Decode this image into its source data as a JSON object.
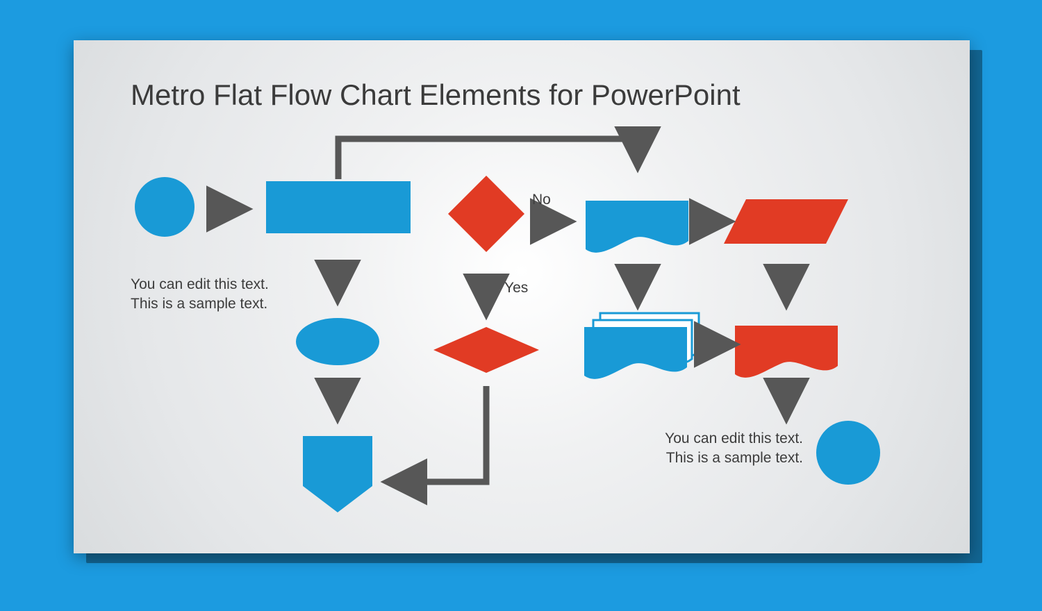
{
  "title": "Metro Flat Flow Chart Elements for PowerPoint",
  "labels": {
    "no": "No",
    "yes": "Yes"
  },
  "captions": {
    "top_left": "You can edit this text. This is a sample text.",
    "bottom_right": "You can edit this text. This is a sample text."
  },
  "colors": {
    "blue": "#199ad6",
    "red": "#e13b24",
    "arrow": "#575757"
  },
  "shapes": [
    {
      "id": "start-circle",
      "kind": "circle",
      "color": "blue"
    },
    {
      "id": "process-rect",
      "kind": "rectangle",
      "color": "blue"
    },
    {
      "id": "decision-diamond",
      "kind": "diamond",
      "color": "red"
    },
    {
      "id": "flag-wave",
      "kind": "flag",
      "color": "blue"
    },
    {
      "id": "data-parallelogram",
      "kind": "parallelogram",
      "color": "red"
    },
    {
      "id": "ellipse-step",
      "kind": "ellipse",
      "color": "blue"
    },
    {
      "id": "flat-diamond",
      "kind": "flat-diamond",
      "color": "red"
    },
    {
      "id": "multi-docs",
      "kind": "multi-document",
      "color": "blue"
    },
    {
      "id": "display-red",
      "kind": "flag",
      "color": "red"
    },
    {
      "id": "offpage-pentagon",
      "kind": "off-page",
      "color": "blue"
    },
    {
      "id": "end-circle",
      "kind": "circle",
      "color": "blue"
    }
  ],
  "chart_data": {
    "type": "flowchart",
    "title": "Metro Flat Flow Chart Elements for PowerPoint",
    "nodes": [
      {
        "id": "start",
        "shape": "terminator-circle",
        "color": "blue",
        "label": ""
      },
      {
        "id": "process",
        "shape": "process-rect",
        "color": "blue",
        "label": ""
      },
      {
        "id": "decision",
        "shape": "decision-diamond",
        "color": "red",
        "label": ""
      },
      {
        "id": "flag",
        "shape": "document-flag",
        "color": "blue",
        "label": ""
      },
      {
        "id": "data",
        "shape": "data-parallelogram",
        "color": "red",
        "label": ""
      },
      {
        "id": "ellipse",
        "shape": "connector-ellipse",
        "color": "blue",
        "label": ""
      },
      {
        "id": "flatdia",
        "shape": "flat-diamond",
        "color": "red",
        "label": ""
      },
      {
        "id": "multidoc",
        "shape": "multi-document",
        "color": "blue",
        "label": ""
      },
      {
        "id": "display",
        "shape": "display-flag",
        "color": "red",
        "label": ""
      },
      {
        "id": "offpage",
        "shape": "off-page-pentagon",
        "color": "blue",
        "label": ""
      },
      {
        "id": "end",
        "shape": "terminator-circle",
        "color": "blue",
        "label": ""
      }
    ],
    "edges": [
      {
        "from": "start",
        "to": "process"
      },
      {
        "from": "process",
        "to": "flag",
        "via": "top-loop"
      },
      {
        "from": "process",
        "to": "ellipse"
      },
      {
        "from": "decision",
        "to": "flag",
        "label": "No"
      },
      {
        "from": "decision",
        "to": "flatdia",
        "label": "Yes"
      },
      {
        "from": "flag",
        "to": "data"
      },
      {
        "from": "flag",
        "to": "multidoc"
      },
      {
        "from": "data",
        "to": "display"
      },
      {
        "from": "multidoc",
        "to": "display"
      },
      {
        "from": "display",
        "to": "end"
      },
      {
        "from": "ellipse",
        "to": "offpage"
      },
      {
        "from": "flatdia",
        "to": "offpage",
        "via": "elbow"
      }
    ],
    "captions": [
      "You can edit this text. This is a sample text.",
      "You can edit this text. This is a sample text."
    ]
  }
}
